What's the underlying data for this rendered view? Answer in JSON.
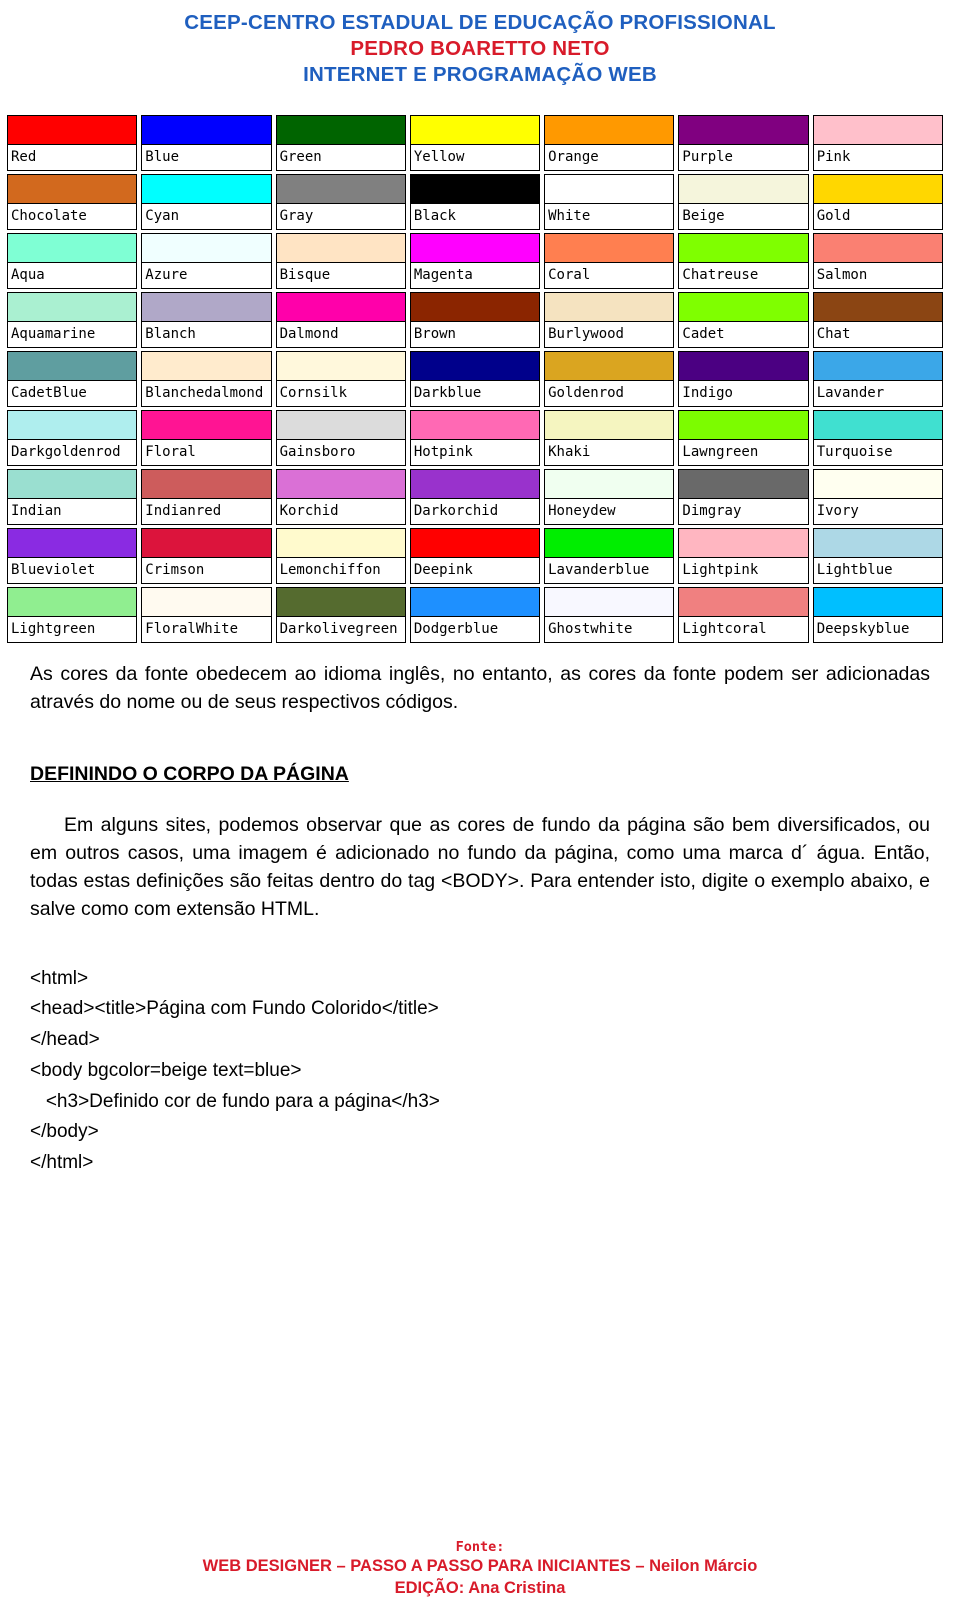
{
  "header": {
    "line1": "CEEP-CENTRO ESTADUAL DE EDUCAÇÃO PROFISSIONAL",
    "line2": "PEDRO BOARETTO NETO",
    "line3": "INTERNET E PROGRAMAÇÃO WEB",
    "color1": "#1F5FBF",
    "color2": "#D81B2A",
    "color3": "#1F5FBF"
  },
  "color_table": {
    "rows": [
      [
        {
          "name": "Red",
          "hex": "#FF0000"
        },
        {
          "name": "Blue",
          "hex": "#0000FF"
        },
        {
          "name": "Green",
          "hex": "#006400"
        },
        {
          "name": "Yellow",
          "hex": "#FFFF00"
        },
        {
          "name": "Orange",
          "hex": "#FF9900"
        },
        {
          "name": "Purple",
          "hex": "#800080"
        },
        {
          "name": "Pink",
          "hex": "#FFC0CB"
        }
      ],
      [
        {
          "name": "Chocolate",
          "hex": "#D2691E"
        },
        {
          "name": "Cyan",
          "hex": "#00FFFF"
        },
        {
          "name": "Gray",
          "hex": "#808080"
        },
        {
          "name": "Black",
          "hex": "#000000"
        },
        {
          "name": "White",
          "hex": "#FFFFFF"
        },
        {
          "name": "Beige",
          "hex": "#F5F5DC"
        },
        {
          "name": "Gold",
          "hex": "#FFD700"
        }
      ],
      [
        {
          "name": "Aqua",
          "hex": "#7FFFD4"
        },
        {
          "name": "Azure",
          "hex": "#F0FFFF"
        },
        {
          "name": "Bisque",
          "hex": "#FFE4C4"
        },
        {
          "name": "Magenta",
          "hex": "#FF00FF"
        },
        {
          "name": "Coral",
          "hex": "#FF7F50"
        },
        {
          "name": "Chatreuse",
          "hex": "#7FFF00"
        },
        {
          "name": "Salmon",
          "hex": "#FA8072"
        }
      ],
      [
        {
          "name": "Aquamarine",
          "hex": "#AAF0D1"
        },
        {
          "name": "Blanch",
          "hex": "#B0A8C8"
        },
        {
          "name": "Dalmond",
          "hex": "#FF00AA"
        },
        {
          "name": "Brown",
          "hex": "#8B2500"
        },
        {
          "name": "Burlywood",
          "hex": "#F5E3C0"
        },
        {
          "name": "Cadet",
          "hex": "#7FFF00"
        },
        {
          "name": "Chat",
          "hex": "#8B4513"
        }
      ],
      [
        {
          "name": "CadetBlue",
          "hex": "#5F9EA0"
        },
        {
          "name": "Blanchedalmond",
          "hex": "#FFEBCD"
        },
        {
          "name": "Cornsilk",
          "hex": "#FFF8DC"
        },
        {
          "name": "Darkblue",
          "hex": "#00008B"
        },
        {
          "name": "Goldenrod",
          "hex": "#DAA520"
        },
        {
          "name": "Indigo",
          "hex": "#4B0082"
        },
        {
          "name": "Lavander",
          "hex": "#3BA7E8"
        }
      ],
      [
        {
          "name": "Darkgoldenrod",
          "hex": "#AFEEEE"
        },
        {
          "name": "Floral",
          "hex": "#FF1493"
        },
        {
          "name": "Gainsboro",
          "hex": "#DCDCDC"
        },
        {
          "name": "Hotpink",
          "hex": "#FF69B4"
        },
        {
          "name": "Khaki",
          "hex": "#F5F5C0"
        },
        {
          "name": "Lawngreen",
          "hex": "#7CFC00"
        },
        {
          "name": "Turquoise",
          "hex": "#40E0D0"
        }
      ],
      [
        {
          "name": "Indian",
          "hex": "#9ADFD0"
        },
        {
          "name": "Indianred",
          "hex": "#CD5C5C"
        },
        {
          "name": "Korchid",
          "hex": "#DA70D6"
        },
        {
          "name": "Darkorchid",
          "hex": "#9932CC"
        },
        {
          "name": "Honeydew",
          "hex": "#F0FFF0"
        },
        {
          "name": "Dimgray",
          "hex": "#696969"
        },
        {
          "name": "Ivory",
          "hex": "#FFFFF0"
        }
      ],
      [
        {
          "name": "Blueviolet",
          "hex": "#8A2BE2"
        },
        {
          "name": "Crimson",
          "hex": "#DC143C"
        },
        {
          "name": "Lemonchiffon",
          "hex": "#FFFACD"
        },
        {
          "name": "Deepink",
          "hex": "#FF0000"
        },
        {
          "name": "Lavanderblue",
          "hex": "#00EE00"
        },
        {
          "name": "Lightpink",
          "hex": "#FFB6C1"
        },
        {
          "name": "Lightblue",
          "hex": "#ADD8E6"
        }
      ],
      [
        {
          "name": "Lightgreen",
          "hex": "#90EE90"
        },
        {
          "name": "FloralWhite",
          "hex": "#FFFAF0"
        },
        {
          "name": "Darkolivegreen",
          "hex": "#556B2F"
        },
        {
          "name": "Dodgerblue",
          "hex": "#1E90FF"
        },
        {
          "name": "Ghostwhite",
          "hex": "#F8F8FF"
        },
        {
          "name": "Lightcoral",
          "hex": "#F08080"
        },
        {
          "name": "Deepskyblue",
          "hex": "#00BFFF"
        }
      ]
    ]
  },
  "content": {
    "intro": "As cores da fonte obedecem ao idioma inglês, no entanto, as cores da fonte podem ser adicionadas através do nome ou de seus respectivos códigos.",
    "section_title": "DEFININDO O CORPO DA PÁGINA",
    "paragraph": "Em alguns sites, podemos observar que as cores de fundo da página são bem diversificados, ou em outros casos, uma imagem é adicionado no fundo da página, como uma marca d´ água. Então, todas estas definições são feitas dentro do tag <BODY>. Para entender isto, digite o exemplo abaixo, e salve como com extensão HTML.",
    "code": "<html>\n<head><title>Página com Fundo Colorido</title>\n</head>\n<body bgcolor=beige text=blue>\n   <h3>Definido cor de fundo para a página</h3>\n</body>\n</html>"
  },
  "footer": {
    "fonte_label": "Fonte:",
    "line1": "WEB DESIGNER – PASSO A PASSO PARA INICIANTES – Neilon Márcio",
    "line2": "EDIÇÃO: Ana Cristina",
    "color": "#D81B2A"
  }
}
